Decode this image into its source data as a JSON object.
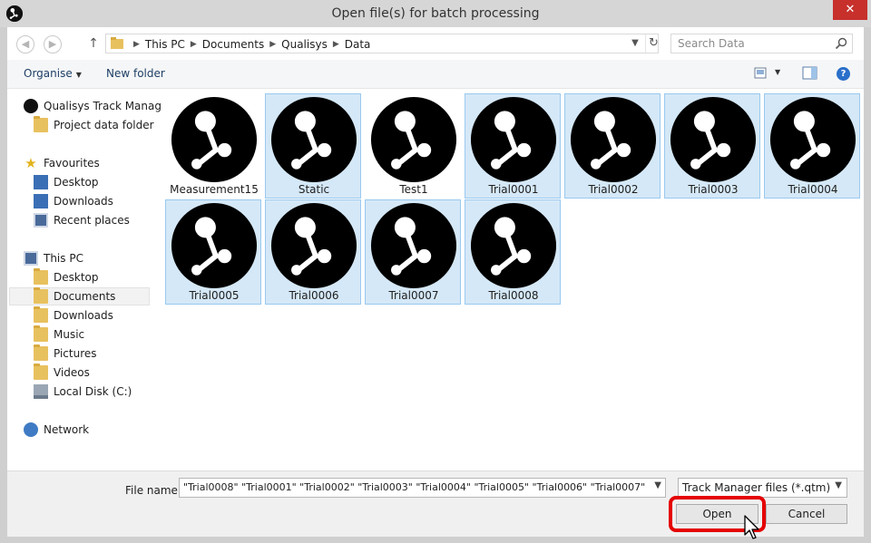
{
  "window": {
    "title": "Open file(s) for batch processing",
    "close_label": "✕"
  },
  "address": {
    "crumbs": [
      "This PC",
      "Documents",
      "Qualisys",
      "Data"
    ],
    "search_placeholder": "Search Data"
  },
  "toolbar": {
    "organise_label": "Organise",
    "new_folder_label": "New folder"
  },
  "navpane": {
    "items": [
      {
        "label": "Qualisys Track Manag",
        "icon": "qualisys-icon",
        "level": 0
      },
      {
        "label": "Project data folder",
        "icon": "folder-icon",
        "level": 1
      },
      {
        "label": "Favourites",
        "icon": "star-icon",
        "level": 0
      },
      {
        "label": "Desktop",
        "icon": "desktop-icon",
        "level": 1
      },
      {
        "label": "Downloads",
        "icon": "downloads-icon",
        "level": 1
      },
      {
        "label": "Recent places",
        "icon": "recent-places-icon",
        "level": 1
      },
      {
        "label": "This PC",
        "icon": "computer-icon",
        "level": 0
      },
      {
        "label": "Desktop",
        "icon": "folder-icon",
        "level": 1
      },
      {
        "label": "Documents",
        "icon": "folder-icon",
        "level": 1,
        "selected": true
      },
      {
        "label": "Downloads",
        "icon": "folder-icon",
        "level": 1
      },
      {
        "label": "Music",
        "icon": "folder-icon",
        "level": 1
      },
      {
        "label": "Pictures",
        "icon": "folder-icon",
        "level": 1
      },
      {
        "label": "Videos",
        "icon": "folder-icon",
        "level": 1
      },
      {
        "label": "Local Disk (C:)",
        "icon": "disk-icon",
        "level": 1
      },
      {
        "label": "Network",
        "icon": "network-icon",
        "level": 0
      }
    ]
  },
  "files": [
    {
      "name": "Measurement15",
      "selected": false
    },
    {
      "name": "Static",
      "selected": true
    },
    {
      "name": "Test1",
      "selected": false
    },
    {
      "name": "Trial0001",
      "selected": true
    },
    {
      "name": "Trial0002",
      "selected": true
    },
    {
      "name": "Trial0003",
      "selected": true
    },
    {
      "name": "Trial0004",
      "selected": true
    },
    {
      "name": "Trial0005",
      "selected": true
    },
    {
      "name": "Trial0006",
      "selected": true
    },
    {
      "name": "Trial0007",
      "selected": true
    },
    {
      "name": "Trial0008",
      "selected": true
    }
  ],
  "footer": {
    "file_name_label": "File name:",
    "file_name_value": "\"Trial0008\" \"Trial0001\" \"Trial0002\" \"Trial0003\" \"Trial0004\" \"Trial0005\" \"Trial0006\" \"Trial0007\"",
    "file_type_value": "Track Manager files (*.qtm)",
    "open_label": "Open",
    "cancel_label": "Cancel"
  },
  "colors": {
    "selection_fill": "#d5e8f7",
    "selection_border": "#99c9ef",
    "highlight": "#e50000",
    "close_button": "#c7302b"
  }
}
